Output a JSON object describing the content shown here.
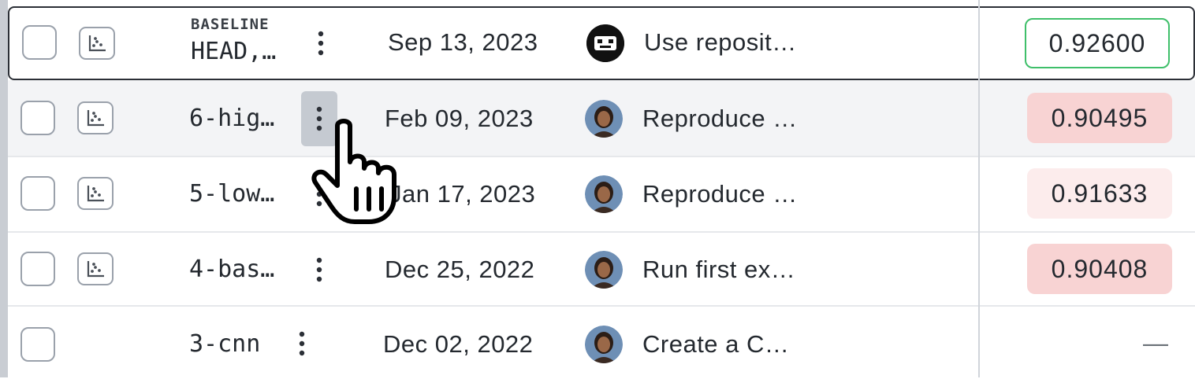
{
  "baseline_label": "BASELINE",
  "rows": [
    {
      "name": "HEAD,…",
      "date": "Sep 13, 2023",
      "message": "Use reposit…",
      "metric": "0.92600",
      "avatar": "bot-avatar"
    },
    {
      "name": "6-hig…",
      "date": "Feb 09, 2023",
      "message": "Reproduce …",
      "metric": "0.90495",
      "avatar": "user-avatar"
    },
    {
      "name": "5-low…",
      "date": "Jan 17, 2023",
      "message": "Reproduce …",
      "metric": "0.91633",
      "avatar": "user-avatar"
    },
    {
      "name": "4-bas…",
      "date": "Dec 25, 2022",
      "message": "Run first ex…",
      "metric": "0.90408",
      "avatar": "user-avatar"
    },
    {
      "name": "3-cnn",
      "date": "Dec 02, 2022",
      "message": "Create a C…",
      "metric": "—",
      "avatar": "user-avatar"
    }
  ],
  "colors": {
    "baseline_border": "#3fbf6a",
    "worse_strong": "#f8d3d3",
    "worse_mild": "#fcecec",
    "hover_row": "#f3f4f6"
  },
  "icons": [
    "checkbox",
    "scatter-plot-icon",
    "kebab-menu-icon",
    "hand-pointer-cursor"
  ]
}
